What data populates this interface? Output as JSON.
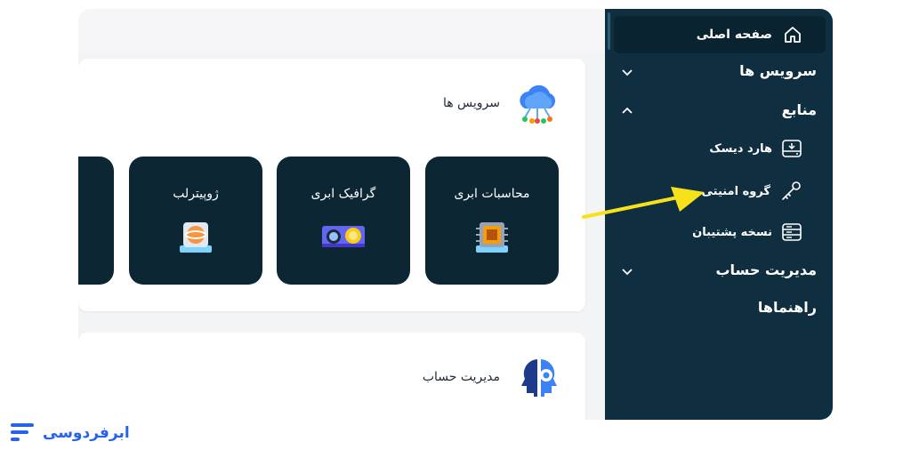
{
  "sidebar": {
    "home": {
      "label": "صفحه اصلی",
      "icon": "home-icon"
    },
    "services": {
      "label": "سرویس ها",
      "expanded": false
    },
    "resources": {
      "label": "منابع",
      "expanded": true,
      "items": [
        {
          "label": "هارد دیسک",
          "icon": "hard-disk-icon"
        },
        {
          "label": "گروه امنیتی",
          "icon": "key-icon"
        },
        {
          "label": "نسخه پشتیبان",
          "icon": "server-icon"
        }
      ]
    },
    "account": {
      "label": "مدیریت حساب",
      "expanded": false
    },
    "guides": {
      "label": "راهنماها"
    }
  },
  "main": {
    "services_panel": {
      "title": "سرویس ها",
      "icon": "cloud-network-icon",
      "cards": [
        {
          "label": "محاسبات ابری",
          "icon": "cpu-chip-icon"
        },
        {
          "label": "گرافیک ابری",
          "icon": "gpu-card-icon"
        },
        {
          "label": "ژوپیترلب",
          "icon": "jupyter-icon"
        }
      ]
    },
    "account_panel": {
      "title": "مدیریت حساب",
      "icon": "head-gear-icon"
    }
  },
  "brand": {
    "name": "ابرفردوسی"
  },
  "colors": {
    "sidebar_bg": "#0f2e3f",
    "card_bg": "#0c2633",
    "accent_arrow": "#f6e21b",
    "brand": "#2563eb"
  }
}
